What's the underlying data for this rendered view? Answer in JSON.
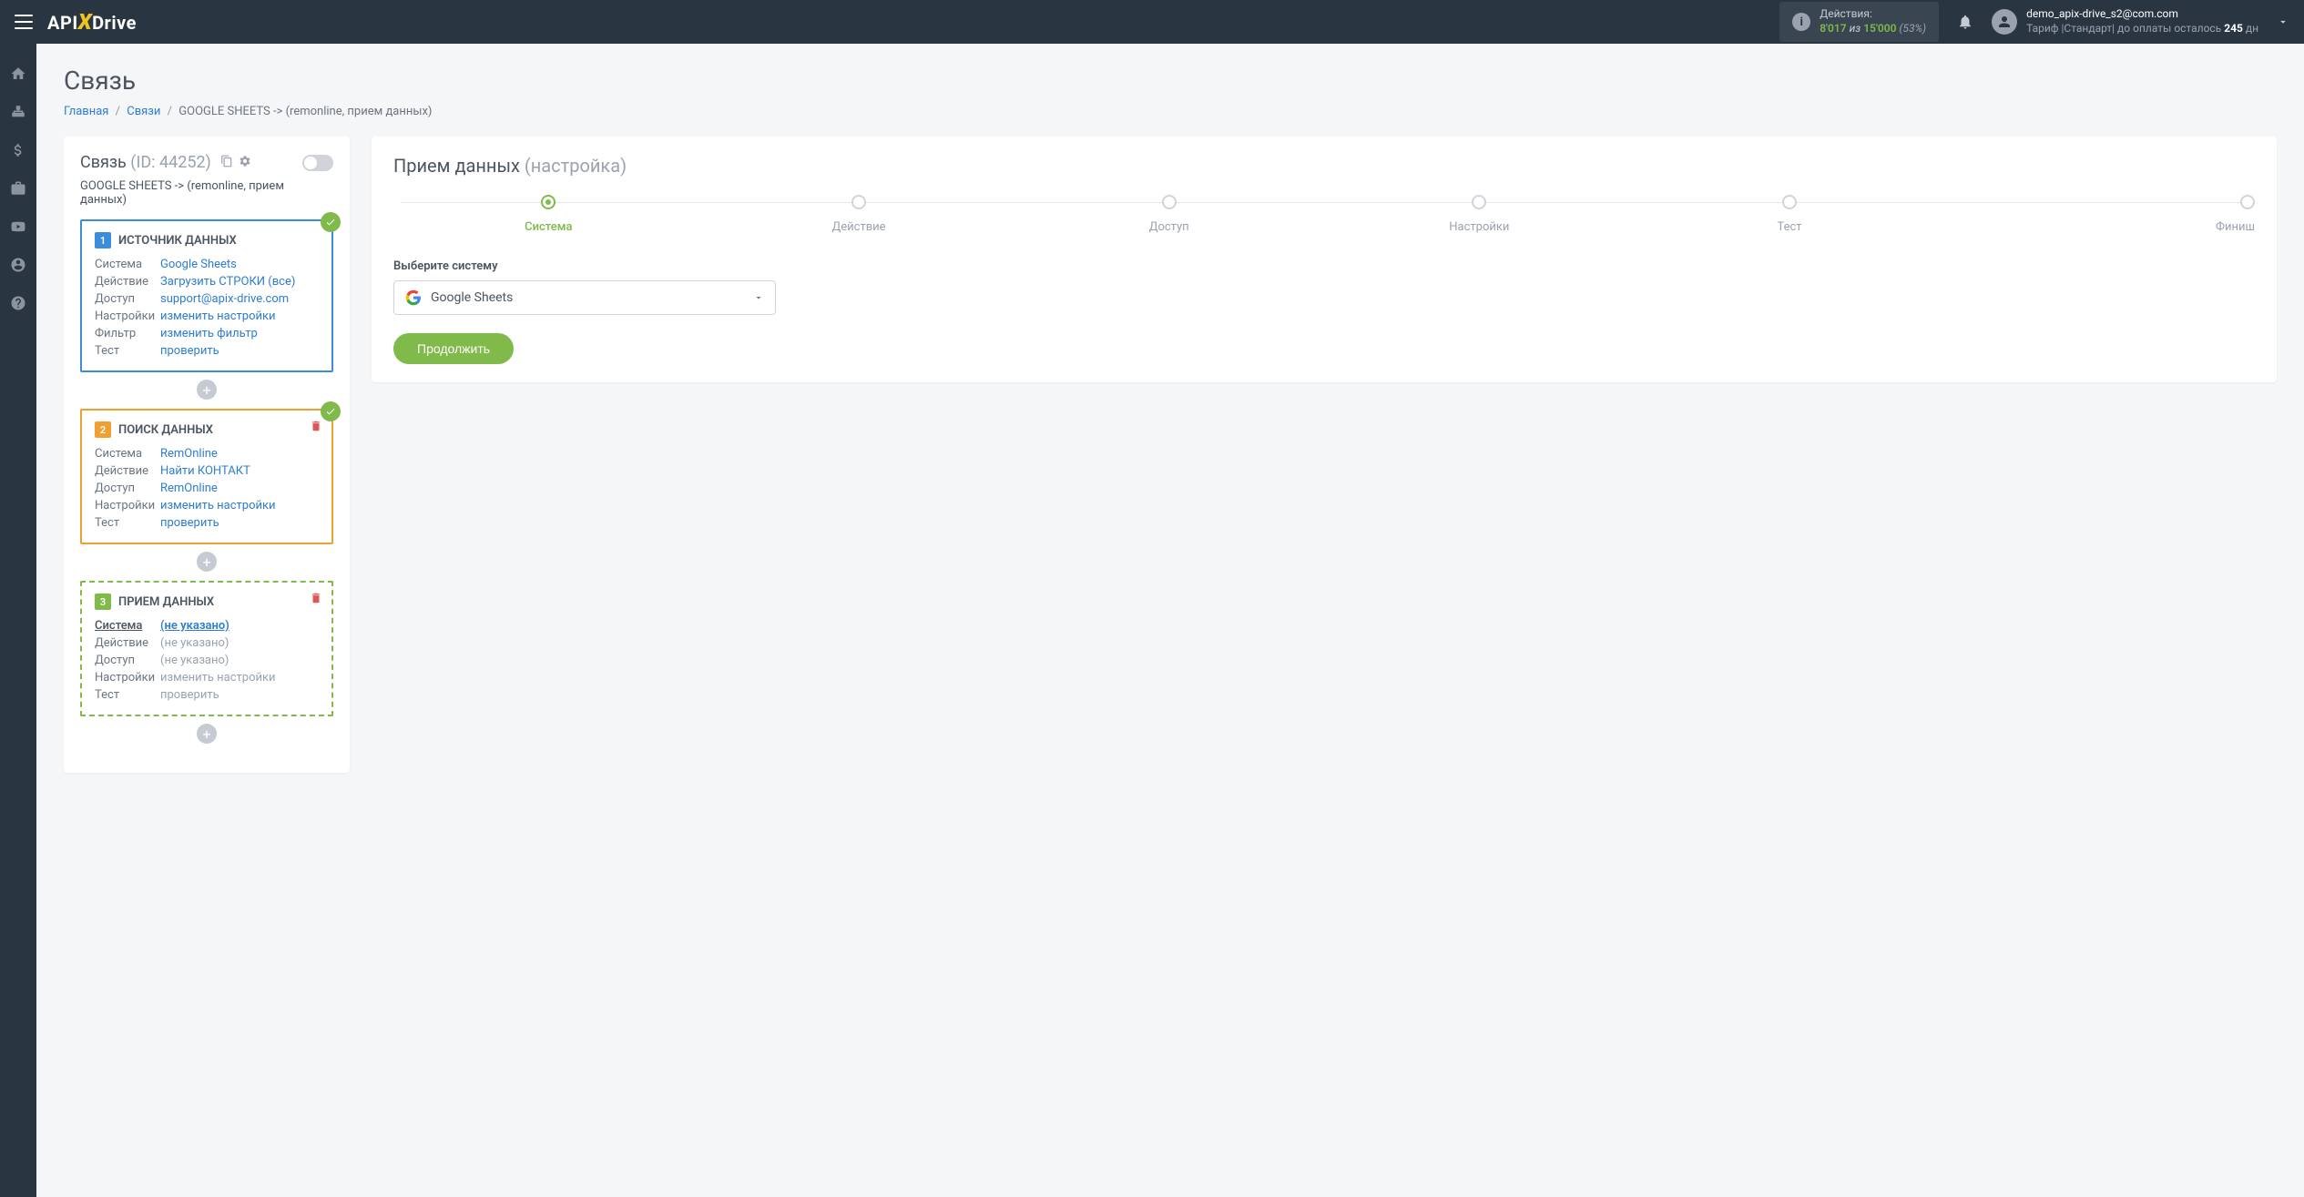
{
  "header": {
    "logo_pre": "API",
    "logo_x": "X",
    "logo_post": "Drive",
    "actions": {
      "label": "Действия:",
      "used": "8'017",
      "sep": "из",
      "total": "15'000",
      "pct": "(53%)"
    },
    "user": {
      "email": "demo_apix-drive_s2@com.com",
      "tariff_pre": "Тариф |Стандарт| до оплаты осталось ",
      "days": "245",
      "tariff_post": " дн"
    }
  },
  "page": {
    "title": "Связь",
    "breadcrumb": {
      "home": "Главная",
      "links": "Связи",
      "current": "GOOGLE SHEETS -> (remonline, прием данных)"
    }
  },
  "left": {
    "title": "Связь",
    "id_label": "(ID: 44252)",
    "subtitle": "GOOGLE SHEETS -> (remonline, прием данных)",
    "blocks": [
      {
        "num": "1",
        "title": "ИСТОЧНИК ДАННЫХ",
        "rows": [
          {
            "label": "Система",
            "value": "Google Sheets"
          },
          {
            "label": "Действие",
            "value": "Загрузить СТРОКИ (все)"
          },
          {
            "label": "Доступ",
            "value": "support@apix-drive.com"
          },
          {
            "label": "Настройки",
            "value": "изменить настройки"
          },
          {
            "label": "Фильтр",
            "value": "изменить фильтр"
          },
          {
            "label": "Тест",
            "value": "проверить"
          }
        ]
      },
      {
        "num": "2",
        "title": "ПОИСК ДАННЫХ",
        "rows": [
          {
            "label": "Система",
            "value": "RemOnline"
          },
          {
            "label": "Действие",
            "value": "Найти КОНТАКТ"
          },
          {
            "label": "Доступ",
            "value": "RemOnline"
          },
          {
            "label": "Настройки",
            "value": "изменить настройки"
          },
          {
            "label": "Тест",
            "value": "проверить"
          }
        ]
      },
      {
        "num": "3",
        "title": "ПРИЕМ ДАННЫХ",
        "rows": [
          {
            "label": "Система",
            "value": "(не указано)"
          },
          {
            "label": "Действие",
            "value": "(не указано)"
          },
          {
            "label": "Доступ",
            "value": "(не указано)"
          },
          {
            "label": "Настройки",
            "value": "изменить настройки"
          },
          {
            "label": "Тест",
            "value": "проверить"
          }
        ]
      }
    ]
  },
  "right": {
    "title": "Прием данных",
    "subtitle": "(настройка)",
    "steps": [
      "Система",
      "Действие",
      "Доступ",
      "Настройки",
      "Тест",
      "Финиш"
    ],
    "field_label": "Выберите систему",
    "select_value": "Google Sheets",
    "btn": "Продолжить"
  }
}
